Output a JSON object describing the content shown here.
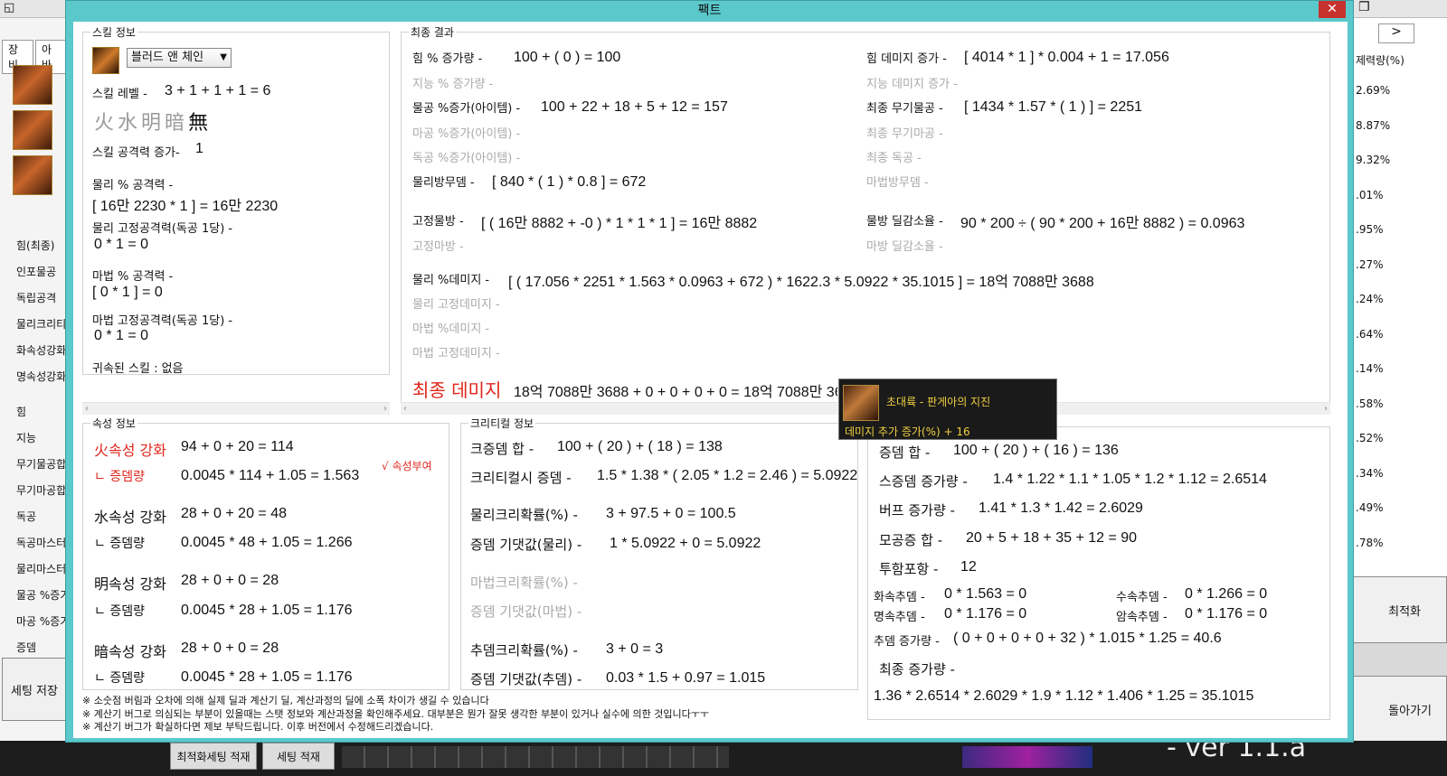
{
  "window": {
    "title": "팩트",
    "close_glyph": "✕"
  },
  "background_app": {
    "top_glyph_left": "◱",
    "top_glyph_right": "❐",
    "tabs": [
      "장비",
      "아바"
    ],
    "left_list_top": [
      "힘(최종)",
      "인포물공",
      "독립공격",
      "물리크리티",
      "화속성강화",
      "명속성강화"
    ],
    "left_list_bottom": [
      "힘",
      "지능",
      "무기물공합",
      "무기마공합",
      "독공",
      "독공마스터",
      "물리마스터",
      "물공 %증가",
      "마공 %증가",
      "증뎀"
    ],
    "save_button": "세팅 저장",
    "right_header": "제력량(%)",
    "right_values": [
      "2.69%",
      "8.87%",
      "9.32%",
      ".01%",
      ".95%",
      ".27%",
      ".24%",
      ".64%",
      ".14%",
      ".58%",
      ".52%",
      ".34%",
      ".49%",
      ".78%"
    ],
    "right_btn_optimize": "최적화",
    "right_btn_back": "돌아가기",
    "right_small_btn": ">",
    "bottom_btn1": "최적화세팅 적재",
    "bottom_btn2": "세팅 적재",
    "version": "- ver 1.1.a"
  },
  "skill_info": {
    "legend": "스킬 정보",
    "skill_select": "블러드 앤 체인",
    "skill_level_label": "스킬 레벨 -",
    "skill_level_value": "3 + 1 + 1 + 1 = 6",
    "elements": [
      "火",
      "水",
      "明",
      "暗",
      "無"
    ],
    "skill_atk_label": "스킬 공격력 증가-",
    "skill_atk_value": "1",
    "phys_pct_label": "물리 % 공격력 -",
    "phys_pct_value": "[ 16만 2230 * 1 ] = 16만 2230",
    "phys_fixed_label": "물리 고정공격력(독공 1당) -",
    "phys_fixed_value": "0 * 1 = 0",
    "mag_pct_label": "마법 % 공격력 -",
    "mag_pct_value": "[ 0 * 1 ] = 0",
    "mag_fixed_label": "마법 고정공격력(독공 1당) -",
    "mag_fixed_value": "0 * 1 = 0",
    "bound_skill": "귀속된 스킬 : 없음"
  },
  "final_result": {
    "legend": "최종 결과",
    "str_pct_label": "힘 % 증가량 -",
    "str_pct_value": "100 + ( 0 ) = 100",
    "int_pct_label": "지능 % 증가량 -",
    "phys_item_label": "물공 %증가(아이템) -",
    "phys_item_value": "100 + 22 + 18 + 5 + 12 = 157",
    "mag_item_label": "마공 %증가(아이템) -",
    "ind_item_label": "독공 %증가(아이템) -",
    "phys_def_label": "물리방무뎀 -",
    "phys_def_value": "[ 840 * ( 1 ) * 0.8 ] = 672",
    "fixed_phys_label": "고정물방 -",
    "fixed_phys_value": "[ ( 16만 8882 + -0 ) * 1 * 1 * 1 ] = 16만 8882",
    "fixed_mag_label": "고정마방 -",
    "phys_dmg_label": "물리 %데미지 -",
    "phys_dmg_value": "[ ( 17.056 * 2251 * 1.563 * 0.0963 + 672 ) * 1622.3 * 5.0922 * 35.1015 ] = 18억 7088만 3688",
    "phys_fixed_dmg_label": "물리 고정데미지 -",
    "mag_dmg_label": "마법 %데미지 -",
    "mag_fixed_dmg_label": "마법 고정데미지 -",
    "str_dmg_label": "힘 데미지 증가 -",
    "str_dmg_value": "[ 4014 * 1 ] * 0.004 + 1 = 17.056",
    "int_dmg_label": "지능 데미지 증가 -",
    "final_weapon_phys_label": "최종 무기물공 -",
    "final_weapon_phys_value": "[ 1434 * 1.57 * ( 1 ) ] = 2251",
    "final_weapon_mag_label": "최종 무기마공 -",
    "final_ind_label": "최종 독공 -",
    "mag_def_label": "마법방무뎀 -",
    "phys_reduce_label": "물방 딜감소율 -",
    "phys_reduce_value": "90 * 200 ÷ ( 90 * 200 + 16만 8882 ) = 0.0963",
    "mag_reduce_label": "마방 딜감소율 -",
    "final_damage_label": "최종 데미지",
    "final_damage_value": "18억 7088만 3688 + 0 + 0 + 0 + 0 = 18억 7088만 3688"
  },
  "element_info": {
    "legend": "속성 정보",
    "fire_label": "火속성 강화",
    "fire_value": "94 + 0 + 20 = 114",
    "fire_dmg_label": "ㄴ 증뎀량",
    "fire_dmg_value": "0.0045 * 114 + 1.05 = 1.563",
    "attr_given": "√ 속성부여",
    "water_label": "水속성 강화",
    "water_value": "28 + 0 + 20 = 48",
    "water_dmg_label": "ㄴ 증뎀량",
    "water_dmg_value": "0.0045 * 48 + 1.05 = 1.266",
    "light_label": "明속성 강화",
    "light_value": "28 + 0 + 0 = 28",
    "light_dmg_label": "ㄴ 증뎀량",
    "light_dmg_value": "0.0045 * 28 + 1.05 = 1.176",
    "dark_label": "暗속성 강화",
    "dark_value": "28 + 0 + 0 = 28",
    "dark_dmg_label": "ㄴ 증뎀량",
    "dark_dmg_value": "0.0045 * 28 + 1.05 = 1.176"
  },
  "critical_info": {
    "legend": "크리티컬 정보",
    "crit_dmg_sum_label": "크증뎀 합 -",
    "crit_dmg_sum_value": "100 + ( 20 ) + ( 18 ) = 138",
    "crit_dmg_label": "크리티컬시 증뎀 -",
    "crit_dmg_value": "1.5 * 1.38 * ( 2.05 * 1.2 = 2.46 ) = 5.0922",
    "phys_crit_rate_label": "물리크리확률(%) -",
    "phys_crit_rate_value": "3 + 97.5 + 0 = 100.5",
    "phys_expect_label": "증뎀 기댓값(물리) -",
    "phys_expect_value": "1 * 5.0922 + 0 = 5.0922",
    "mag_crit_rate_label": "마법크리확률(%) -",
    "mag_expect_label": "증뎀 기댓값(마법) -",
    "add_crit_rate_label": "추뎀크리확률(%) -",
    "add_crit_rate_value": "3 + 0 = 3",
    "add_expect_label": "증뎀 기댓값(추뎀) -",
    "add_expect_value": "0.03 * 1.5 + 0.97 = 1.015"
  },
  "damage_info": {
    "dmg_sum_label": "증뎀 합 -",
    "dmg_sum_value": "100 + ( 20 ) + ( 16 ) = 136",
    "skill_dmg_label": "스증뎀 증가량 -",
    "skill_dmg_value": "1.4 * 1.22 * 1.1 * 1.05 * 1.2 * 1.12 = 2.6514",
    "buff_label": "버프 증가량 -",
    "buff_value": "1.41 * 1.3 * 1.42 = 2.6029",
    "all_atk_label": "모공증 합 -",
    "all_atk_value": "20 + 5 + 18 + 35 + 12 = 90",
    "pierce_label": "투함포항 -",
    "pierce_value": "12",
    "fire_add_label": "화속추뎀 -",
    "fire_add_value": "0 * 1.563 = 0",
    "water_add_label": "수속추뎀 -",
    "water_add_value": "0 * 1.266 = 0",
    "light_add_label": "명속추뎀 -",
    "light_add_value": "0 * 1.176 = 0",
    "dark_add_label": "암속추뎀 -",
    "dark_add_value": "0 * 1.176 = 0",
    "add_dmg_label": "추뎀 증가량 -",
    "add_dmg_value": "( 0 + 0 + 0 + 0 + 32 ) * 1.015 * 1.25 = 40.6",
    "final_inc_label": "최종 증가량 -",
    "final_inc_value": "1.36 * 2.6514 * 2.6029 * 1.9 * 1.12 * 1.406 * 1.25 = 35.1015"
  },
  "tooltip": {
    "name": "초대륙 - 판게아의 지진",
    "effect": "데미지 추가 증가(%) + 16"
  },
  "notes": [
    "※ 소숫점 버림과 오차에 의해 실제 딜과 계산기 딜, 계산과정의 딜에 소폭 차이가 생길 수 있습니다",
    "※ 계산기 버그로 의심되는 부분이 있을때는 스탯 정보와 계산과정을 확인해주세요. 대부분은 뭔가 잘못 생각한 부분이 있거나 실수에 의한 것입니다ㅜㅜ",
    "※ 계산기 버그가 확실하다면 제보 부탁드립니다. 이후 버전에서 수정해드리겠습니다."
  ],
  "scroll": {
    "left_arrow": "‹",
    "right_arrow": "›"
  }
}
